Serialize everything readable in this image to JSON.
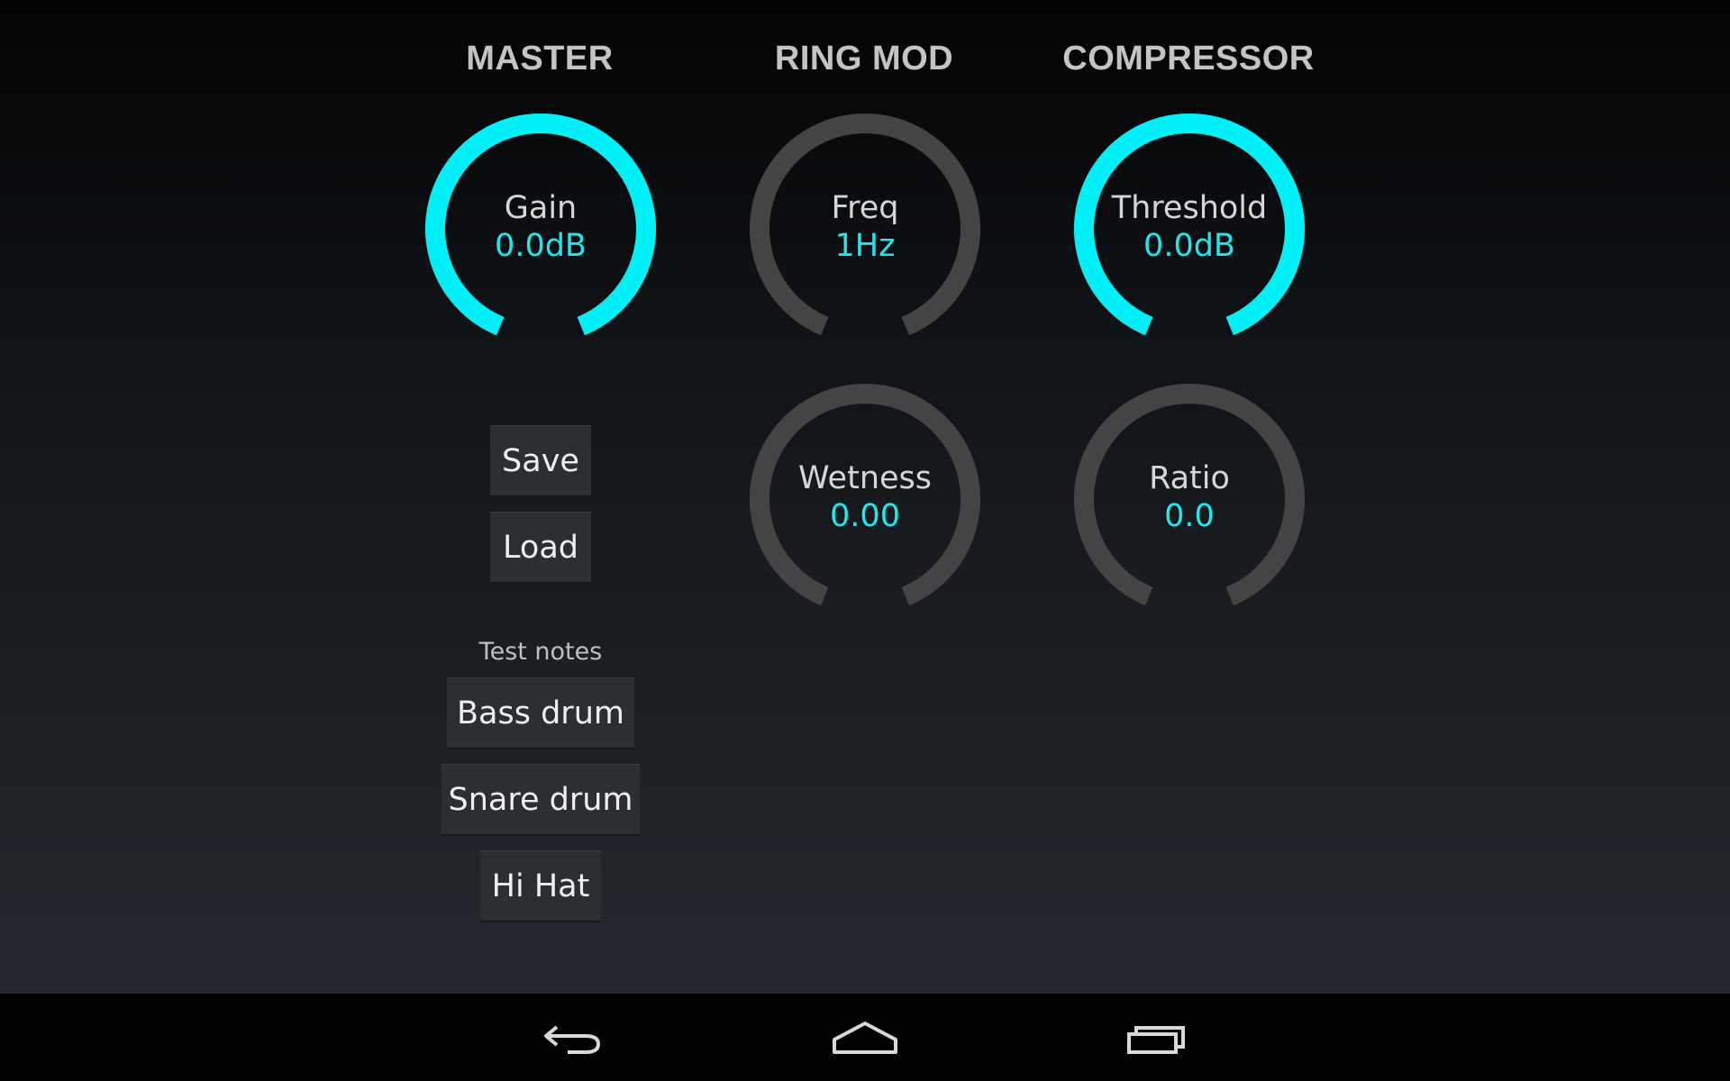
{
  "sections": {
    "master": "MASTER",
    "ring_mod": "RING MOD",
    "compressor": "COMPRESSOR"
  },
  "knobs": {
    "gain": {
      "label": "Gain",
      "value": "0.0dB",
      "level": 1.0
    },
    "freq": {
      "label": "Freq",
      "value": "1Hz",
      "level": 0.0
    },
    "threshold": {
      "label": "Threshold",
      "value": "0.0dB",
      "level": 1.0
    },
    "wetness": {
      "label": "Wetness",
      "value": "0.00",
      "level": 0.0
    },
    "ratio": {
      "label": "Ratio",
      "value": "0.0",
      "level": 0.0
    }
  },
  "buttons": {
    "save": "Save",
    "load": "Load",
    "bass_drum": "Bass drum",
    "snare_drum": "Snare drum",
    "hi_hat": "Hi Hat"
  },
  "test_notes_label": "Test notes",
  "colors": {
    "accent": "#00f0f8",
    "track": "#444444",
    "value_text": "#1ee8ee"
  },
  "navbar": {
    "back_icon": "back-arrow-icon",
    "home_icon": "home-icon",
    "recents_icon": "recent-apps-icon"
  }
}
